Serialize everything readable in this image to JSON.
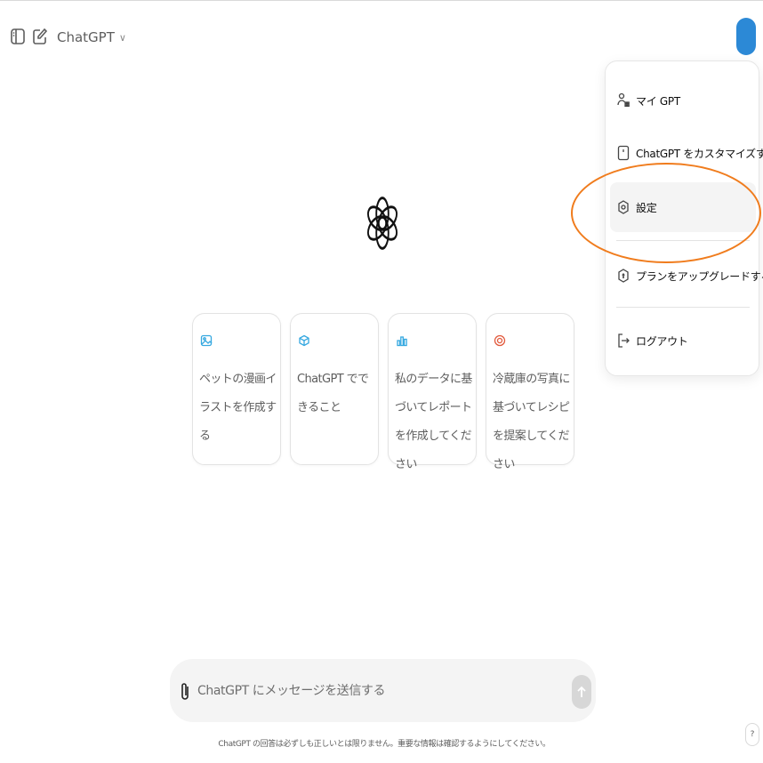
{
  "header": {
    "model_name": "ChatGPT",
    "model_chevron": "∨",
    "sidebar_icon": "sidebar-toggle-icon",
    "new_chat_icon": "new-chat-icon"
  },
  "menu": {
    "items": [
      {
        "label": "マイ GPT",
        "icon": "person-grid-icon"
      },
      {
        "label": "ChatGPT をカスタマイズする",
        "icon": "customize-icon"
      },
      {
        "label": "設定",
        "icon": "gear-icon"
      },
      {
        "label": "プランをアップグレードする",
        "icon": "upgrade-icon"
      },
      {
        "label": "ログアウト",
        "icon": "logout-icon"
      }
    ]
  },
  "suggestions": [
    {
      "text": "ペットの漫画イラストを作成する",
      "icon": "image-icon",
      "color": "#35a8e0"
    },
    {
      "text": "ChatGPT でできること",
      "icon": "cube-icon",
      "color": "#35a8e0"
    },
    {
      "text": "私のデータに基づいてレポートを作成してください",
      "icon": "chart-icon",
      "color": "#35a8e0"
    },
    {
      "text": "冷蔵庫の写真に基づいてレシピを提案してください",
      "icon": "target-icon",
      "color": "#e2593c"
    }
  ],
  "composer": {
    "placeholder": "ChatGPT にメッセージを送信する",
    "attach_icon": "paperclip-icon",
    "send_icon": "arrow-up-icon"
  },
  "footer": {
    "disclaimer": "ChatGPT の回答は必ずしも正しいとは限りません。重要な情報は確認するようにしてください。"
  },
  "help": {
    "label": "?"
  },
  "colors": {
    "accent_oval": "#f07c1d",
    "avatar": "#2c89d6",
    "composer_bg": "#f4f4f4"
  }
}
